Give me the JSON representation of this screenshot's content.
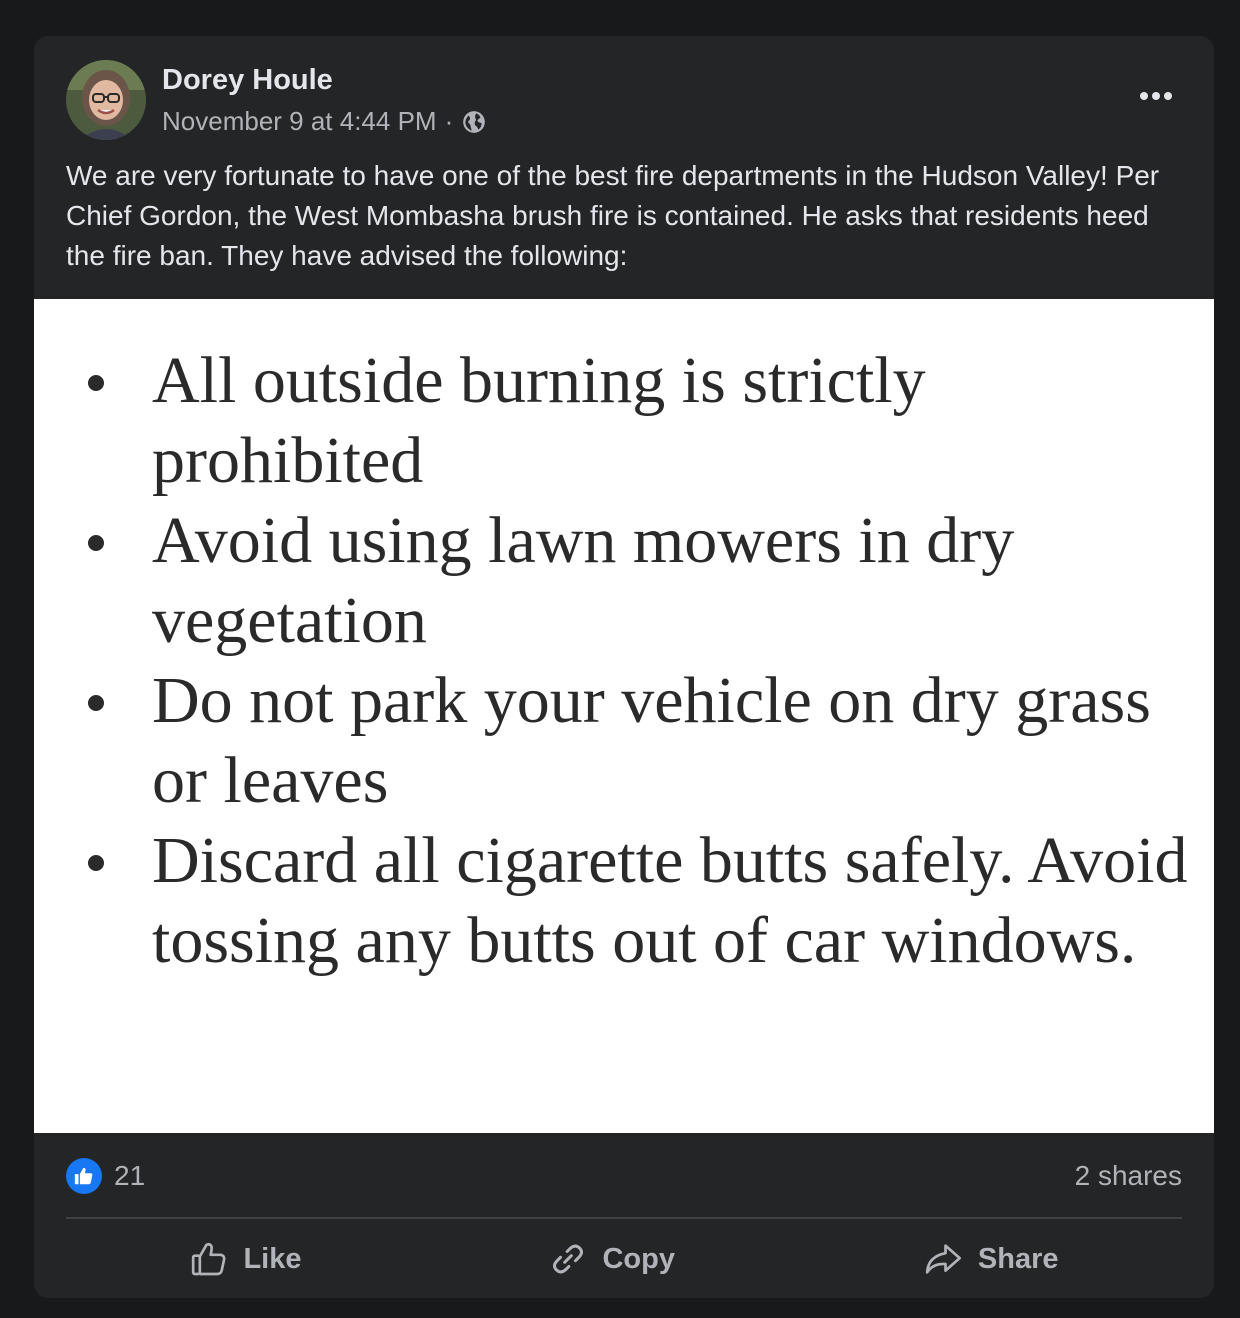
{
  "post": {
    "author": "Dorey Houle",
    "timestamp": "November 9 at 4:44 PM",
    "separator": "·",
    "audience_icon": "globe-icon",
    "menu_icon": "more-options-icon",
    "text": "We are very fortunate to have one of the best fire departments in the Hudson Valley! Per Chief Gordon, the West Mombasha brush fire is contained. He asks that residents heed the fire ban. They have advised the following:",
    "attachment": {
      "items": [
        "All outside burning is strictly prohibited",
        "Avoid using lawn mowers in dry vegetation",
        "Do not park your vehicle on dry grass or leaves",
        "Discard all cigarette butts safely. Avoid tossing any butts out of car windows."
      ]
    },
    "reactions": {
      "icon": "like-icon",
      "count": "21"
    },
    "shares": "2 shares",
    "actions": {
      "like": "Like",
      "copy": "Copy",
      "share": "Share"
    }
  },
  "colors": {
    "background": "#18191a",
    "card": "#242526",
    "primary_text": "#e4e6eb",
    "secondary_text": "#b0b3b8",
    "accent": "#1877f2"
  }
}
